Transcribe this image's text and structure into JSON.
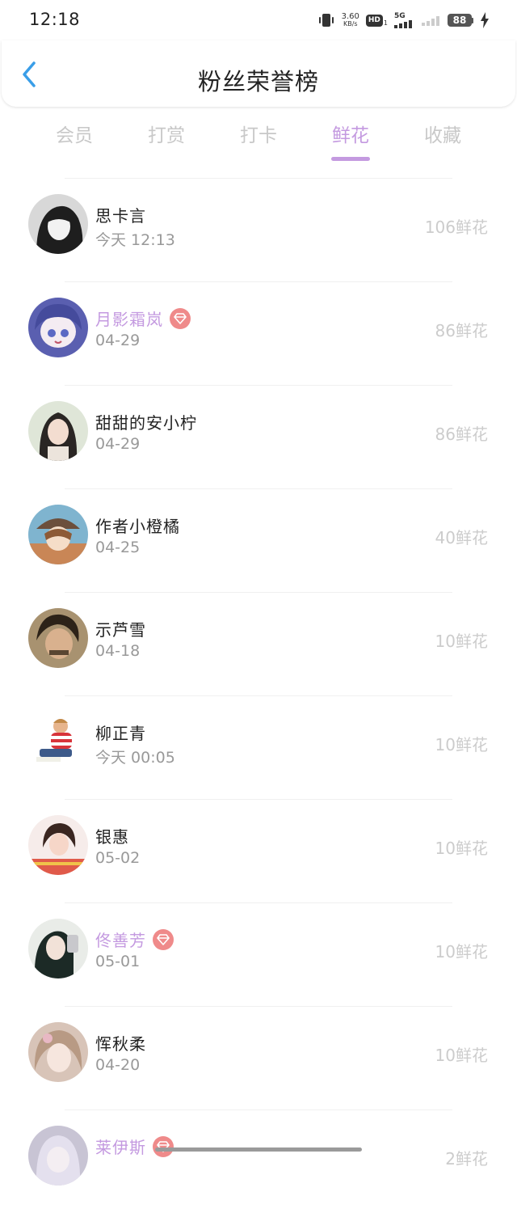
{
  "status_bar": {
    "time": "12:18",
    "net_speed_value": "3.60",
    "net_speed_unit": "KB/s",
    "hd_label": "HD",
    "hd_sub": "1",
    "network_type": "5G",
    "battery": "88"
  },
  "header": {
    "title": "粉丝荣誉榜",
    "back_icon": "chevron-left-icon"
  },
  "tabs": [
    {
      "label": "会员",
      "active": false
    },
    {
      "label": "打赏",
      "active": false
    },
    {
      "label": "打卡",
      "active": false
    },
    {
      "label": "鲜花",
      "active": true
    },
    {
      "label": "收藏",
      "active": false
    }
  ],
  "colors": {
    "accent": "#c49ae0",
    "vip_badge": "#ef8a8a",
    "muted_text": "#999999",
    "count_text": "#cccccc"
  },
  "fans": [
    {
      "name": "思卡言",
      "time": "今天 12:13",
      "count": "106鲜花",
      "vip": false
    },
    {
      "name": "月影霜岚",
      "time": "04-29",
      "count": "86鲜花",
      "vip": true
    },
    {
      "name": "甜甜的安小柠",
      "time": "04-29",
      "count": "86鲜花",
      "vip": false
    },
    {
      "name": "作者小橙橘",
      "time": "04-25",
      "count": "40鲜花",
      "vip": false
    },
    {
      "name": "示芦雪",
      "time": "04-18",
      "count": "10鲜花",
      "vip": false
    },
    {
      "name": "柳正青",
      "time": "今天 00:05",
      "count": "10鲜花",
      "vip": false
    },
    {
      "name": "银惠",
      "time": "05-02",
      "count": "10鲜花",
      "vip": false
    },
    {
      "name": "佟善芳",
      "time": "05-01",
      "count": "10鲜花",
      "vip": true
    },
    {
      "name": "恽秋柔",
      "time": "04-20",
      "count": "10鲜花",
      "vip": false
    },
    {
      "name": "莱伊斯",
      "time": "",
      "count": "2鲜花",
      "vip": true
    }
  ]
}
